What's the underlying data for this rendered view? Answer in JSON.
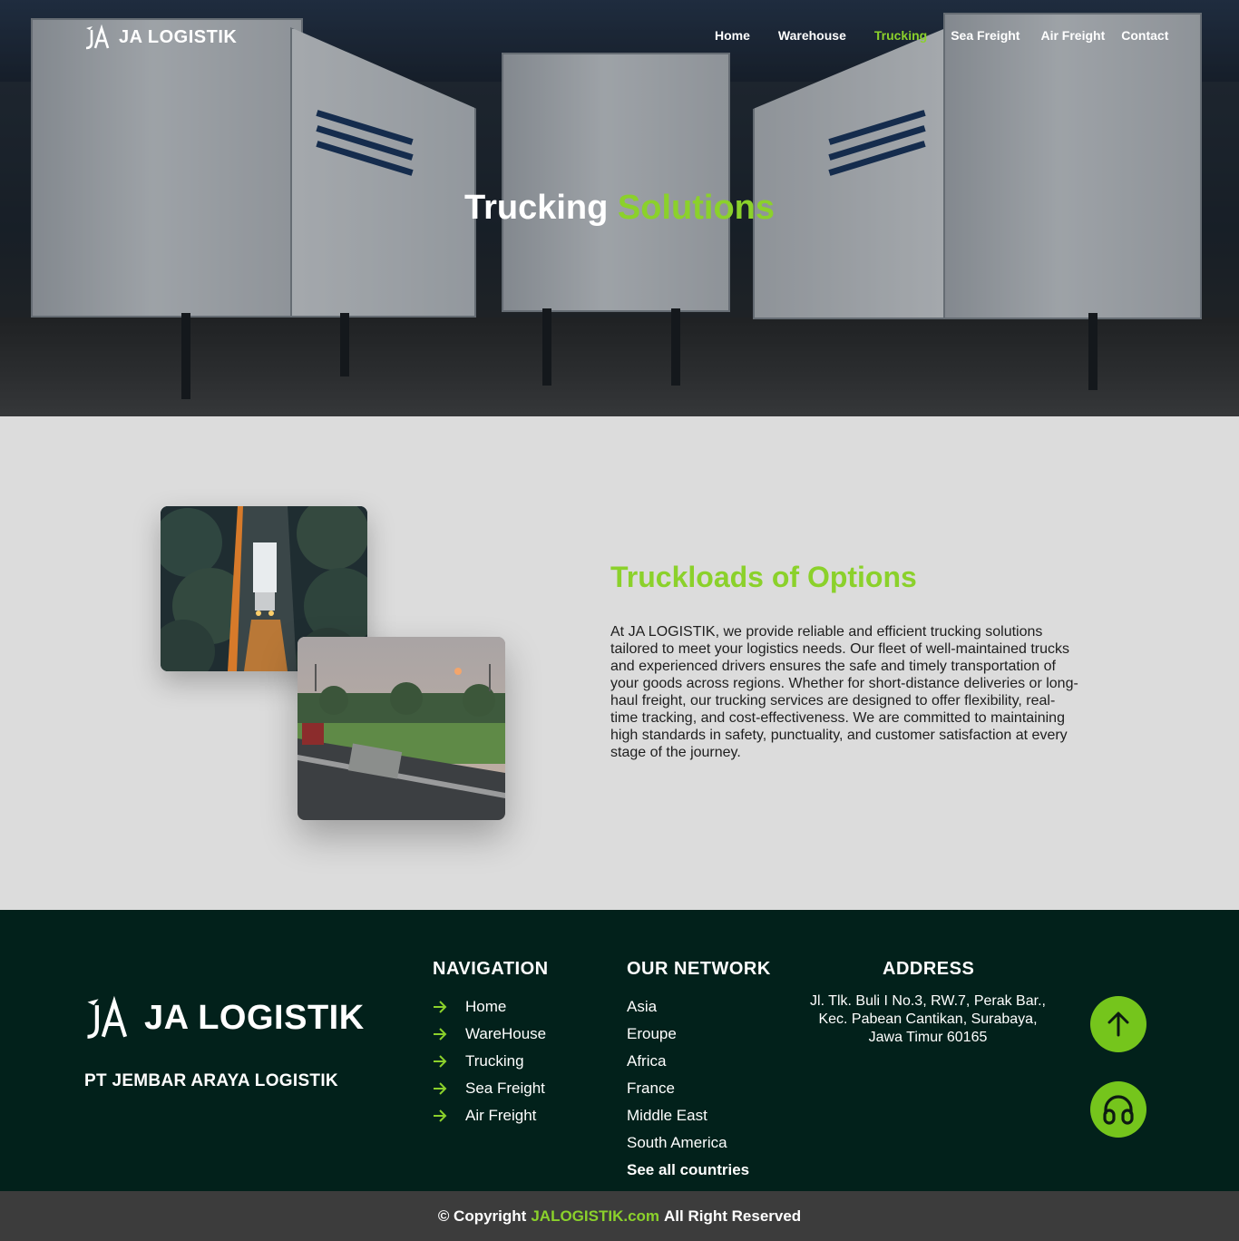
{
  "header": {
    "brand": "JA LOGISTIK",
    "nav": [
      "Home",
      "Warehouse",
      "Trucking",
      "Sea Freight",
      "Air Freight",
      "Contact"
    ],
    "active_nav": "Trucking"
  },
  "hero": {
    "title_part1": "Trucking",
    "title_part2": "Solutions"
  },
  "main": {
    "title": "Truckloads of Options",
    "body": "At JA LOGISTIK, we provide reliable and efficient trucking solutions tailored to meet your logistics needs. Our fleet of well-maintained trucks and experienced drivers ensures the safe and timely transportation of your goods across regions. Whether for short-distance deliveries or long-haul freight, our trucking services are designed to offer flexibility, real-time tracking, and cost-effectiveness. We are committed to maintaining high standards in safety, punctuality, and customer satisfaction at every stage of the journey."
  },
  "footer": {
    "brand": "JA LOGISTIK",
    "company": "PT JEMBAR ARAYA LOGISTIK",
    "navigation": {
      "heading": "NAVIGATION",
      "items": [
        "Home",
        "WareHouse",
        "Trucking",
        "Sea Freight",
        "Air Freight"
      ]
    },
    "network": {
      "heading": "OUR NETWORK",
      "items": [
        "Asia",
        "Eroupe",
        "Africa",
        "France",
        "Middle East",
        "South America",
        "See all countries"
      ]
    },
    "address": {
      "heading": "ADDRESS",
      "text": "Jl. Tlk. Buli I No.3, RW.7, Perak Bar., Kec. Pabean Cantikan, Surabaya, Jawa Timur 60165"
    }
  },
  "copyright": {
    "prefix": "© Copyright",
    "site": "JALOGISTIK.com",
    "suffix": "All Right Reserved"
  },
  "colors": {
    "accent": "#8bd12b",
    "footer_bg": "#02211b",
    "bottom_bg": "#3c3c3c",
    "page_bg": "#dcdcdc"
  },
  "icons": [
    "logo-mark-icon",
    "arrow-right-icon",
    "arrow-up-icon",
    "headset-icon"
  ]
}
